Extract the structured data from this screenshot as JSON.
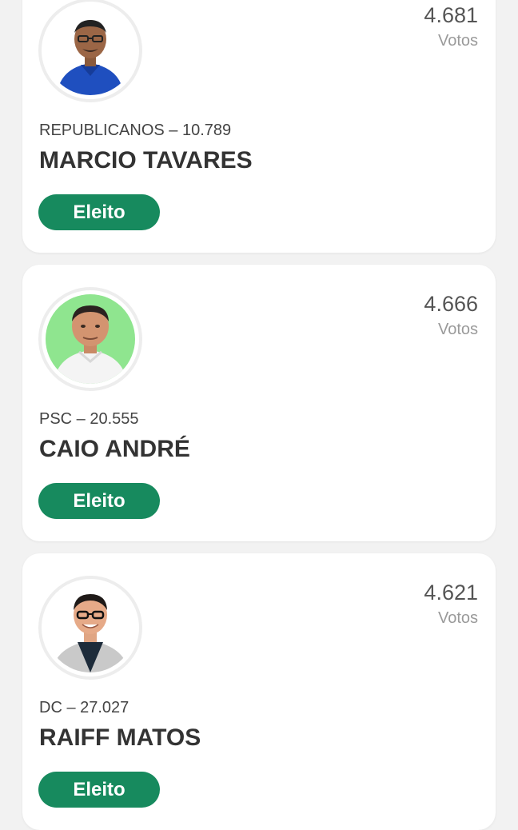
{
  "candidates": [
    {
      "votes": "4.681",
      "votes_label": "Votos",
      "party": "REPUBLICANOS – 10.789",
      "name": "MARCIO TAVARES",
      "status": "Eleito"
    },
    {
      "votes": "4.666",
      "votes_label": "Votos",
      "party": "PSC – 20.555",
      "name": "CAIO ANDRÉ",
      "status": "Eleito"
    },
    {
      "votes": "4.621",
      "votes_label": "Votos",
      "party": "DC – 27.027",
      "name": "RAIFF MATOS",
      "status": "Eleito"
    }
  ],
  "colors": {
    "status_badge": "#178a5e",
    "page_background": "#f2f2f2",
    "card_background": "#ffffff"
  }
}
